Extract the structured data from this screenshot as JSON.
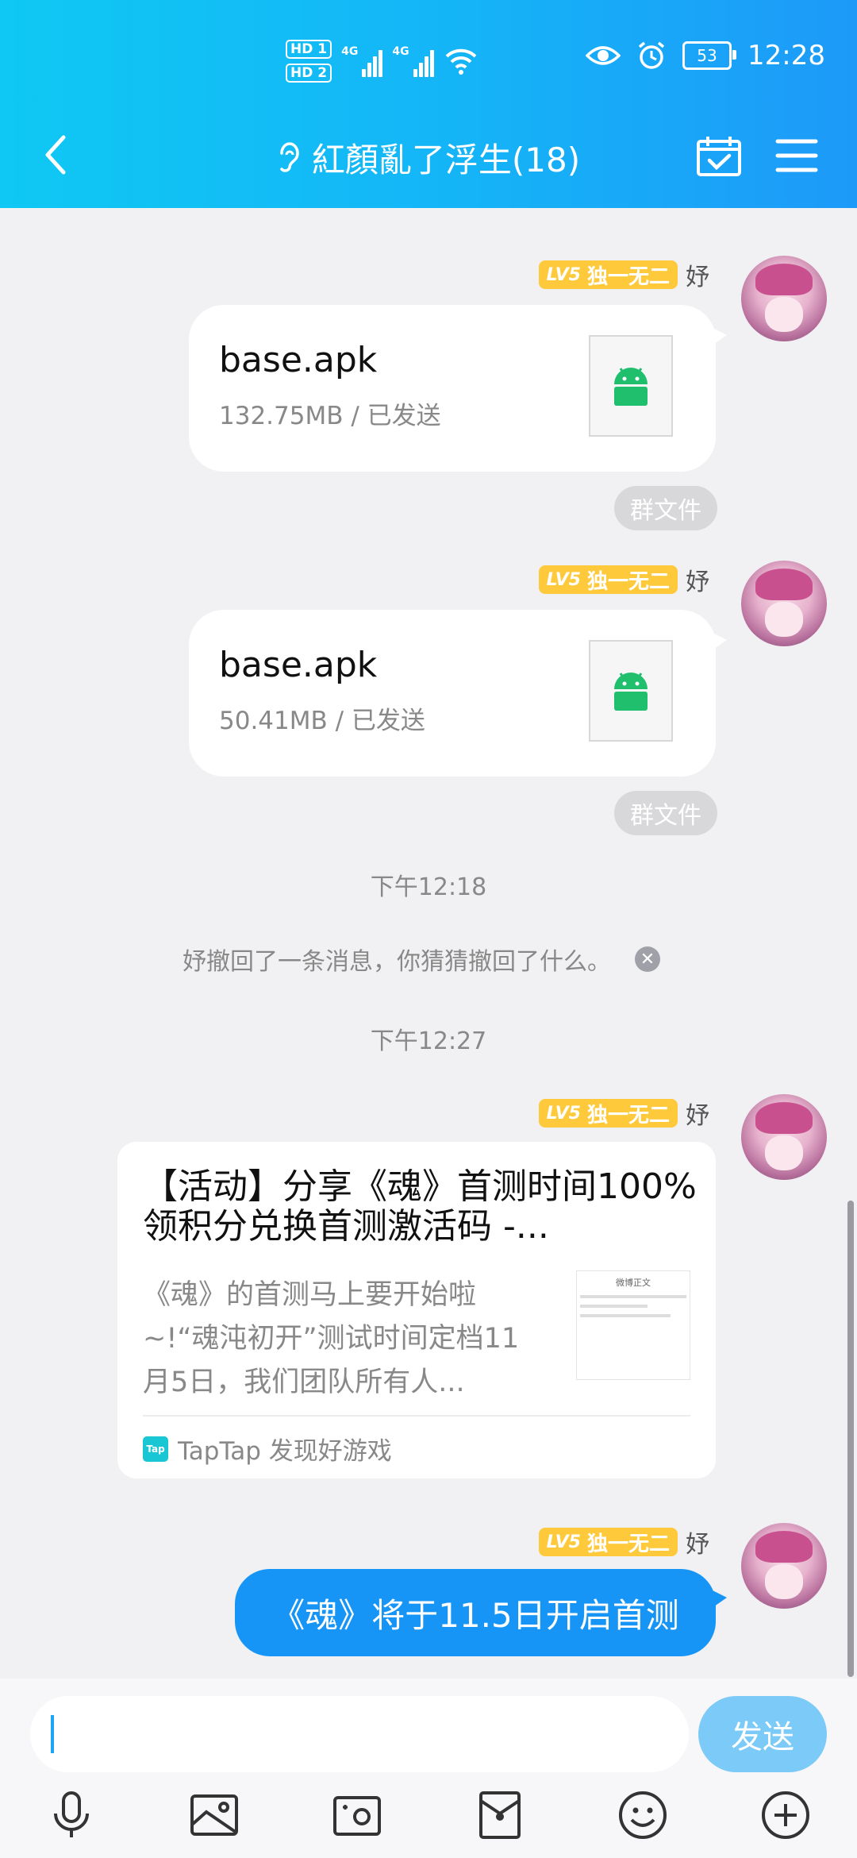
{
  "status_bar": {
    "hd1": "HD 1",
    "hd2": "HD 2",
    "net1": "4G",
    "net2": "4G",
    "battery": "53",
    "time": "12:28"
  },
  "header": {
    "title": "紅顏亂了浮生(18)",
    "icons": [
      "back-arrow",
      "ear",
      "calendar-check",
      "menu"
    ]
  },
  "messages": {
    "file1": {
      "level": "LV5",
      "title": "独一无二",
      "sender": "妤",
      "name": "base.apk",
      "meta": "132.75MB / 已发送",
      "badge": "群文件"
    },
    "file2": {
      "level": "LV5",
      "title": "独一无二",
      "sender": "妤",
      "name": "base.apk",
      "meta": "50.41MB / 已发送",
      "badge": "群文件"
    },
    "time1": "下午12:18",
    "recall": "妤撤回了一条消息，你猜猜撤回了什么。",
    "time2": "下午12:27",
    "card": {
      "level": "LV5",
      "title": "独一无二",
      "sender": "妤",
      "headline": "【活动】分享《魂》首测时间100%领积分兑换首测激活码 -...",
      "desc": "《魂》的首测马上要开始啦~!“魂沌初开”测试时间定档11月5日，我们团队所有人...",
      "thumb_title": "微博正文",
      "source": "TapTap 发现好游戏",
      "logo": "Tap"
    },
    "text1": {
      "level": "LV5",
      "title": "独一无二",
      "sender": "妤",
      "text": "《魂》将于11.5日开启首测"
    }
  },
  "input": {
    "placeholder": "",
    "send_label": "发送"
  },
  "colors": {
    "header_start": "#0fc8f3",
    "header_end": "#1d9af8",
    "level_badge": "#ffc93c",
    "self_bubble": "#1695f6",
    "send_button": "#7ccaf7",
    "android_green": "#1fbf6d"
  }
}
